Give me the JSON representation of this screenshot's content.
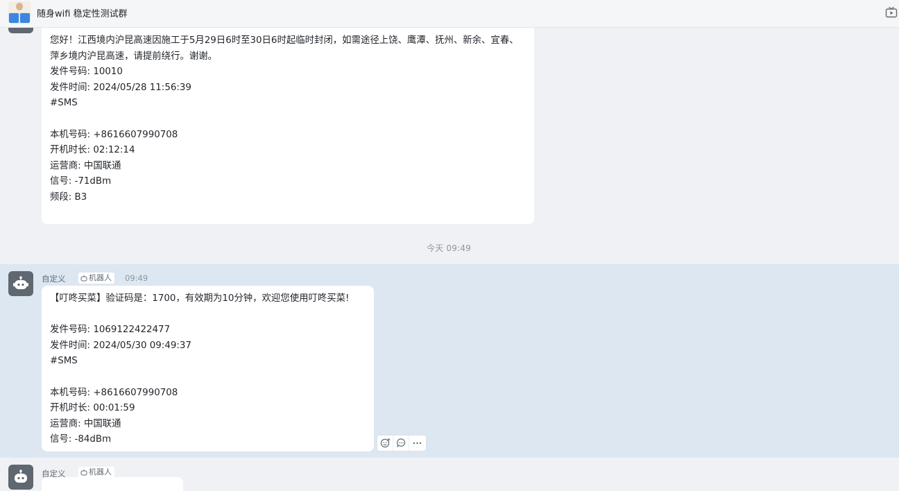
{
  "header": {
    "group_name": "随身wifi 稳定性测试群",
    "avatar_icon": "group-avatar-collage",
    "right_icon": "tv-play-icon"
  },
  "messages": [
    {
      "lines": [
        "您好！江西境内沪昆高速因施工于5月29日6时至30日6时起临时封闭，如需途径上饶、鹰潭、抚州、新余、宜春、萍乡境内沪昆高速，请提前绕行。谢谢。",
        "",
        "发件号码: 10010",
        "发件时间: 2024/05/28 11:56:39",
        "#SMS",
        "",
        "本机号码: +8616607990708",
        "开机时长: 02:12:14",
        "运营商: 中国联通",
        "信号: -71dBm",
        "频段: B3"
      ]
    },
    {
      "sender": "自定义",
      "tag": "机器人",
      "time": "09:49",
      "lines": [
        "【叮咚买菜】验证码是：1700，有效期为10分钟，欢迎您使用叮咚买菜!",
        "",
        "发件号码: 1069122422477",
        "发件时间: 2024/05/30 09:49:37",
        "#SMS",
        "",
        "本机号码: +8616607990708",
        "开机时长: 00:01:59",
        "运营商: 中国联通",
        "信号: -84dBm"
      ]
    },
    {
      "sender": "自定义",
      "tag": "机器人"
    }
  ],
  "divider": "今天 09:49",
  "actions": [
    "add-reaction-icon",
    "reply-icon",
    "more-icon"
  ],
  "colors": {
    "highlight": "#dce7f2",
    "bot_avatar": "#5f6770",
    "background": "#f0f1f4"
  }
}
